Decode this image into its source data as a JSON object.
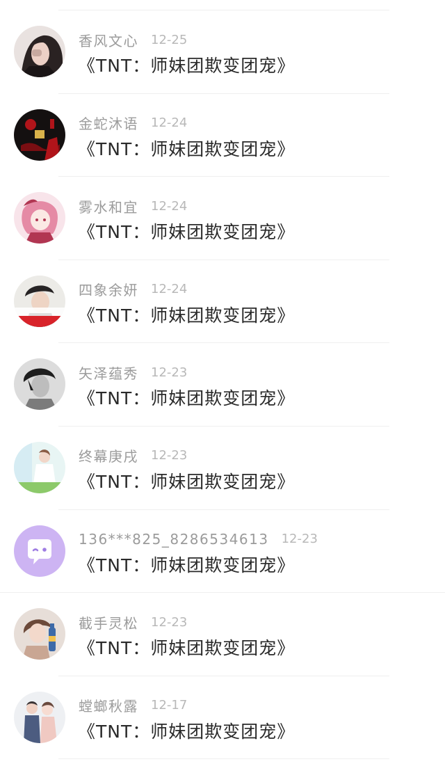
{
  "comments": [
    {
      "user": "香风文心",
      "date": "12-25",
      "title": "《TNT：师妹团欺变团宠》",
      "avatar_icon": "woman-portrait-avatar",
      "avatar_colors": [
        "#e9e2e0",
        "#2a2222",
        "#c7a9a0"
      ]
    },
    {
      "user": "金蛇沐语",
      "date": "12-24",
      "title": "《TNT：师妹团欺变团宠》",
      "avatar_icon": "red-dark-art-avatar",
      "avatar_colors": [
        "#141010",
        "#b0141a",
        "#d9b24a"
      ]
    },
    {
      "user": "雾水和宜",
      "date": "12-24",
      "title": "《TNT：师妹团欺变团宠》",
      "avatar_icon": "pink-anime-avatar",
      "avatar_colors": [
        "#f8e4ea",
        "#e58aa5",
        "#b13652"
      ]
    },
    {
      "user": "四象余妍",
      "date": "12-24",
      "title": "《TNT：师妹团欺变团宠》",
      "avatar_icon": "boy-red-banner-avatar",
      "avatar_colors": [
        "#ecebe7",
        "#262324",
        "#d8232a"
      ]
    },
    {
      "user": "矢泽蕴秀",
      "date": "12-23",
      "title": "《TNT：师妹团欺变团宠》",
      "avatar_icon": "grayscale-portrait-avatar",
      "avatar_colors": [
        "#dcdcdc",
        "#1e1e1e",
        "#7b7b7b"
      ]
    },
    {
      "user": "终幕庚戌",
      "date": "12-23",
      "title": "《TNT：师妹团欺变团宠》",
      "avatar_icon": "girl-pastel-avatar",
      "avatar_colors": [
        "#e8f5f4",
        "#f1d6c8",
        "#8cc96a"
      ]
    },
    {
      "user": "136***825_8286534613",
      "date": "12-23",
      "title": "《TNT：师妹团欺变团宠》",
      "avatar_icon": "default-chat-bubble-avatar",
      "avatar_colors": [
        "#cdb4f3",
        "#ffffff",
        "#9f7de3"
      ]
    },
    {
      "user": "截手灵松",
      "date": "12-23",
      "title": "《TNT：师妹团欺变团宠》",
      "avatar_icon": "girl-with-bottle-avatar",
      "avatar_colors": [
        "#e7ded8",
        "#6c4a3a",
        "#3d6aa8"
      ]
    },
    {
      "user": "螳螂秋露",
      "date": "12-17",
      "title": "《TNT：师妹团欺变团宠》",
      "avatar_icon": "couple-photo-avatar",
      "avatar_colors": [
        "#eef0f3",
        "#4c5c80",
        "#f0c9c2"
      ]
    }
  ]
}
